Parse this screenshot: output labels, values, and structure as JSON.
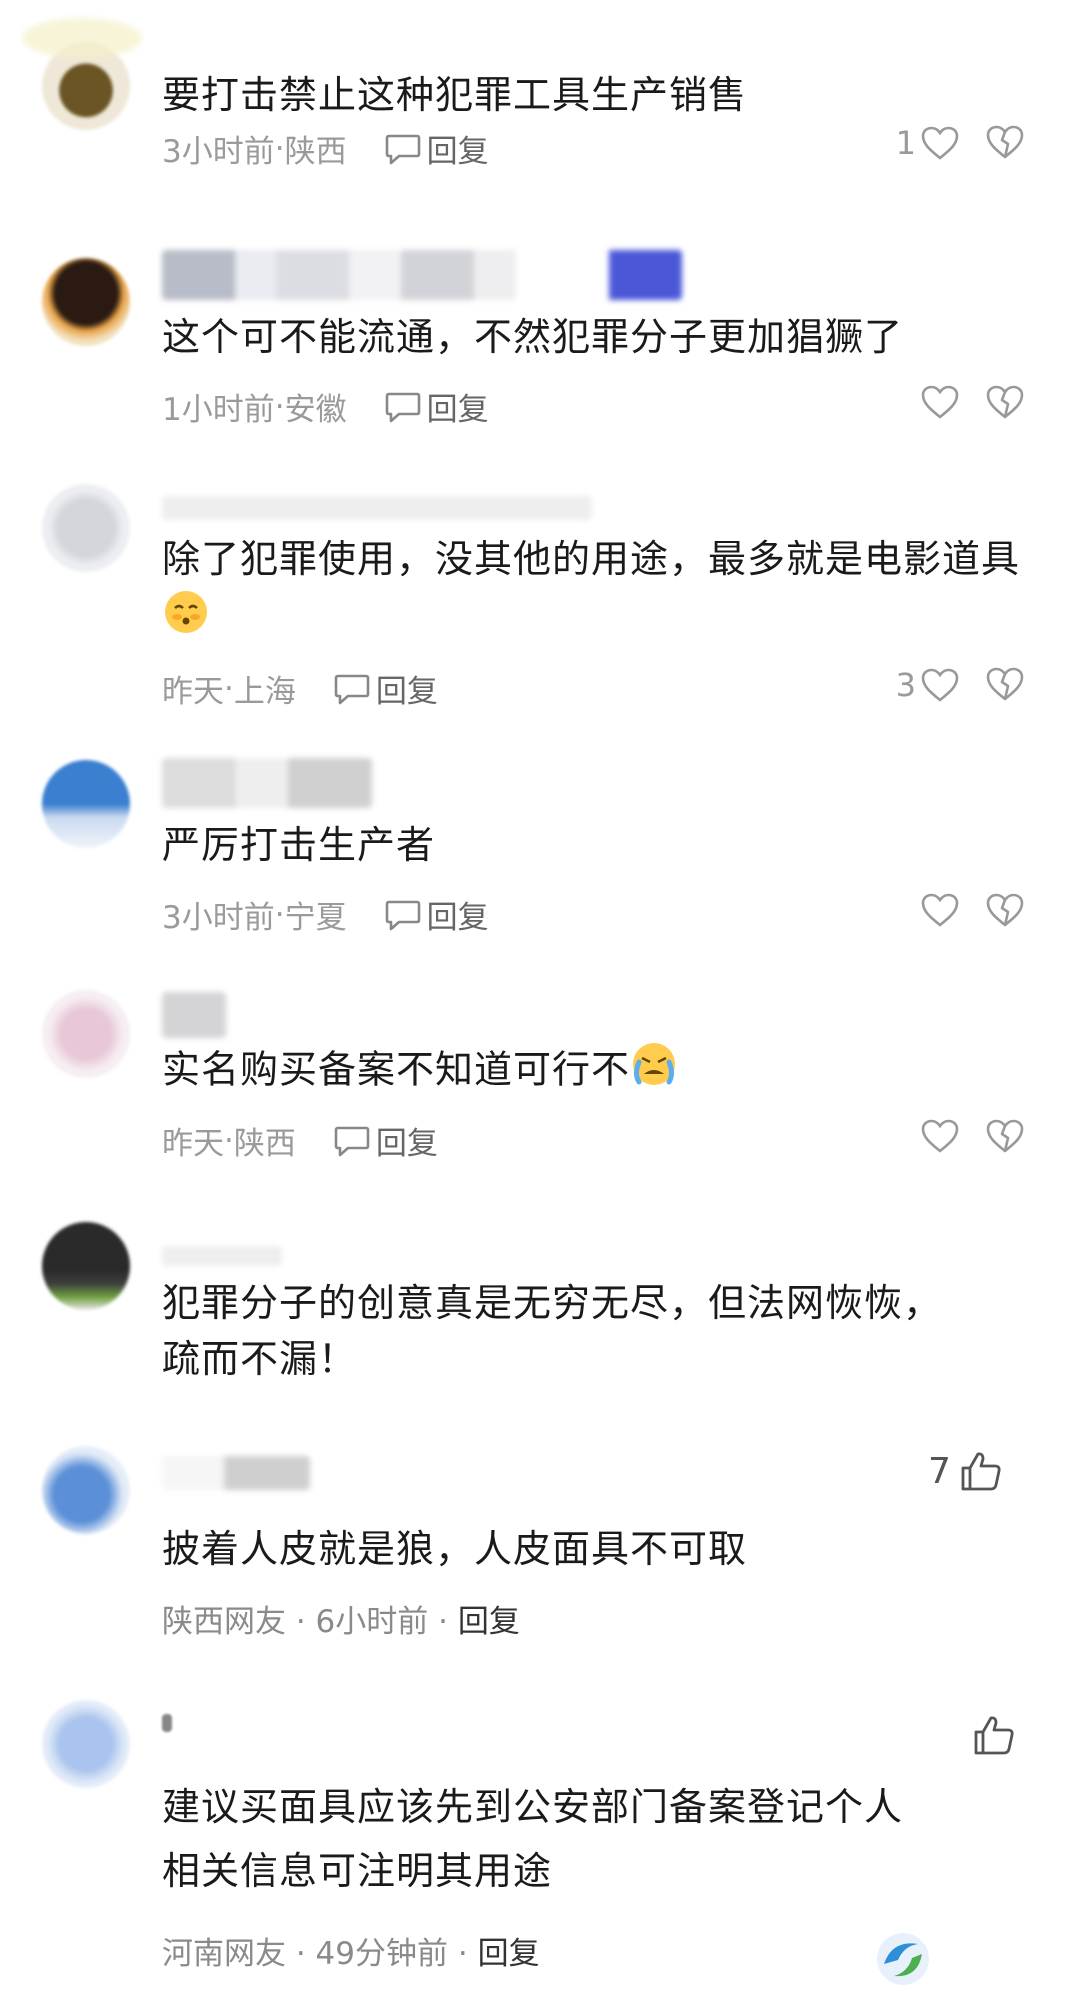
{
  "comments": [
    {
      "text": "要打击禁止这种犯罪工具生产销售",
      "time": "3小时前",
      "region": "陕西",
      "reply_label": "回复",
      "likes": "1"
    },
    {
      "text": "这个可不能流通，不然犯罪分子更加猖獗了",
      "time": "1小时前",
      "region": "安徽",
      "reply_label": "回复",
      "likes": ""
    },
    {
      "text": "除了犯罪使用，没其他的用途，最多就是电影道具",
      "time": "昨天",
      "region": "上海",
      "reply_label": "回复",
      "likes": "3"
    },
    {
      "text": "严厉打击生产者",
      "time": "3小时前",
      "region": "宁夏",
      "reply_label": "回复",
      "likes": ""
    },
    {
      "text": "实名购买备案不知道可行不",
      "time": "昨天",
      "region": "陕西",
      "reply_label": "回复",
      "likes": ""
    },
    {
      "text_line1": "犯罪分子的创意真是无穷无尽，但法网恢恢，",
      "text_line2": "疏而不漏！"
    },
    {
      "text": "披着人皮就是狼，人皮面具不可取",
      "meta": "陕西网友 · 6小时前 · ",
      "reply_label": "回复",
      "likes": "7"
    },
    {
      "text_line1": "建议买面具应该先到公安部门备案登记个人",
      "text_line2": "相关信息可注明其用途",
      "meta": "河南网友 · 49分钟前 · ",
      "reply_label": "回复",
      "likes": ""
    }
  ],
  "separator": " · ",
  "icons": {
    "like": "heart-outline-icon",
    "dislike": "broken-heart-icon",
    "reply": "speech-bubble-icon",
    "thumb": "thumbs-up-icon"
  },
  "colors": {
    "text": "#1a1a1a",
    "meta": "#9a9a9a",
    "icon": "#888888"
  }
}
